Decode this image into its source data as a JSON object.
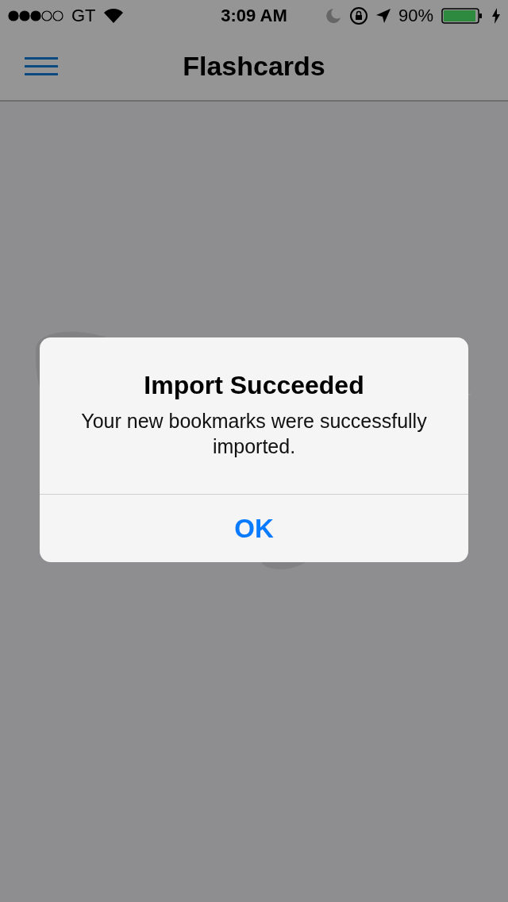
{
  "status_bar": {
    "carrier": "GT",
    "time": "3:09 AM",
    "battery": "90%"
  },
  "nav": {
    "title": "Flashcards"
  },
  "alert": {
    "title": "Import Succeeded",
    "message": "Your new bookmarks were successfully imported.",
    "buttons": [
      "OK"
    ]
  }
}
